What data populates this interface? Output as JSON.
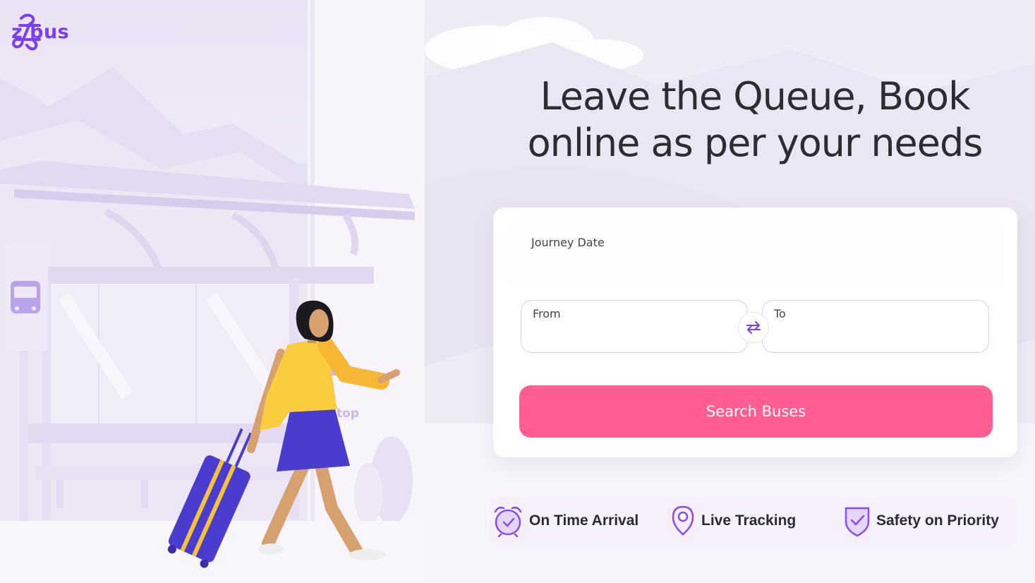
{
  "brand": {
    "name": "z bus",
    "accent_color": "#7a3ff0"
  },
  "hero": {
    "headline_line1": "Leave the Queue, Book",
    "headline_line2": "online as per your needs"
  },
  "illustration": {
    "sign_text": "top"
  },
  "booking": {
    "journey_date_label": "Journey Date",
    "from_label": "From",
    "to_label": "To",
    "swap_icon": "swap-arrows-icon",
    "search_button_label": "Search Buses",
    "search_button_color": "#ff5e93"
  },
  "features": [
    {
      "icon": "alarm-clock-icon",
      "label": "On Time Arrival"
    },
    {
      "icon": "location-pin-icon",
      "label": "Live Tracking"
    },
    {
      "icon": "shield-check-icon",
      "label": "Safety on Priority"
    }
  ]
}
